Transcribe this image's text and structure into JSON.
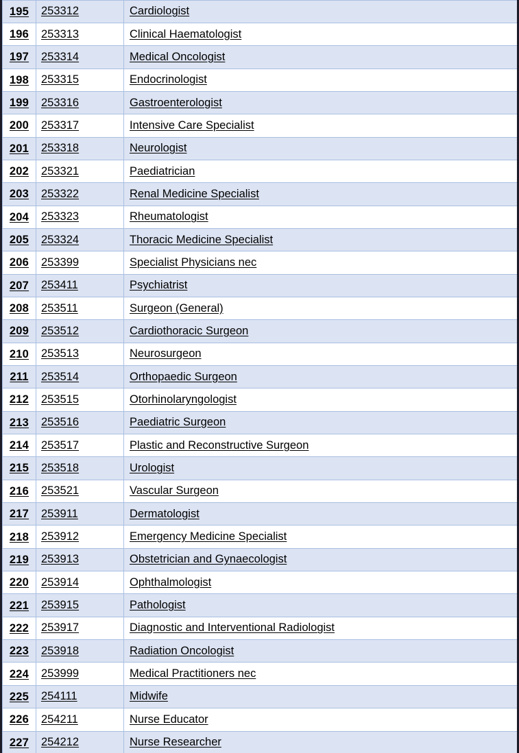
{
  "document": {
    "kind": "spreadsheet-table",
    "colors": {
      "row_shade": "#dce3f2",
      "row_plain": "#ffffff",
      "grid_line": "#a9bfe2",
      "outer_frame": "#1c1c28",
      "text": "#000000"
    }
  },
  "table": {
    "columns": [
      {
        "key": "index",
        "label": ""
      },
      {
        "key": "code",
        "label": ""
      },
      {
        "key": "title",
        "label": ""
      }
    ],
    "rows": [
      {
        "index": "195",
        "code": "253312",
        "title": "Cardiologist"
      },
      {
        "index": "196",
        "code": "253313",
        "title": "Clinical Haematologist"
      },
      {
        "index": "197",
        "code": "253314",
        "title": "Medical Oncologist"
      },
      {
        "index": "198",
        "code": "253315",
        "title": "Endocrinologist"
      },
      {
        "index": "199",
        "code": "253316",
        "title": "Gastroenterologist"
      },
      {
        "index": "200",
        "code": "253317",
        "title": "Intensive Care Specialist"
      },
      {
        "index": "201",
        "code": "253318",
        "title": "Neurologist"
      },
      {
        "index": "202",
        "code": "253321",
        "title": "Paediatrician"
      },
      {
        "index": "203",
        "code": "253322",
        "title": "Renal Medicine Specialist"
      },
      {
        "index": "204",
        "code": "253323",
        "title": "Rheumatologist"
      },
      {
        "index": "205",
        "code": "253324",
        "title": "Thoracic Medicine Specialist"
      },
      {
        "index": "206",
        "code": "253399",
        "title": "Specialist Physicians nec"
      },
      {
        "index": "207",
        "code": "253411",
        "title": "Psychiatrist"
      },
      {
        "index": "208",
        "code": "253511",
        "title": "Surgeon (General)"
      },
      {
        "index": "209",
        "code": "253512",
        "title": "Cardiothoracic Surgeon"
      },
      {
        "index": "210",
        "code": "253513",
        "title": "Neurosurgeon"
      },
      {
        "index": "211",
        "code": "253514",
        "title": "Orthopaedic Surgeon"
      },
      {
        "index": "212",
        "code": "253515",
        "title": "Otorhinolaryngologist"
      },
      {
        "index": "213",
        "code": "253516",
        "title": "Paediatric Surgeon"
      },
      {
        "index": "214",
        "code": "253517",
        "title": "Plastic and Reconstructive Surgeon"
      },
      {
        "index": "215",
        "code": "253518",
        "title": "Urologist"
      },
      {
        "index": "216",
        "code": "253521",
        "title": "Vascular Surgeon"
      },
      {
        "index": "217",
        "code": "253911",
        "title": "Dermatologist"
      },
      {
        "index": "218",
        "code": "253912",
        "title": "Emergency Medicine Specialist"
      },
      {
        "index": "219",
        "code": "253913",
        "title": "Obstetrician and Gynaecologist"
      },
      {
        "index": "220",
        "code": "253914",
        "title": "Ophthalmologist"
      },
      {
        "index": "221",
        "code": "253915",
        "title": "Pathologist"
      },
      {
        "index": "222",
        "code": "253917",
        "title": "Diagnostic and Interventional Radiologist"
      },
      {
        "index": "223",
        "code": "253918",
        "title": "Radiation Oncologist"
      },
      {
        "index": "224",
        "code": "253999",
        "title": "Medical Practitioners nec"
      },
      {
        "index": "225",
        "code": "254111",
        "title": "Midwife"
      },
      {
        "index": "226",
        "code": "254211",
        "title": "Nurse Educator"
      },
      {
        "index": "227",
        "code": "254212",
        "title": "Nurse Researcher"
      }
    ]
  }
}
